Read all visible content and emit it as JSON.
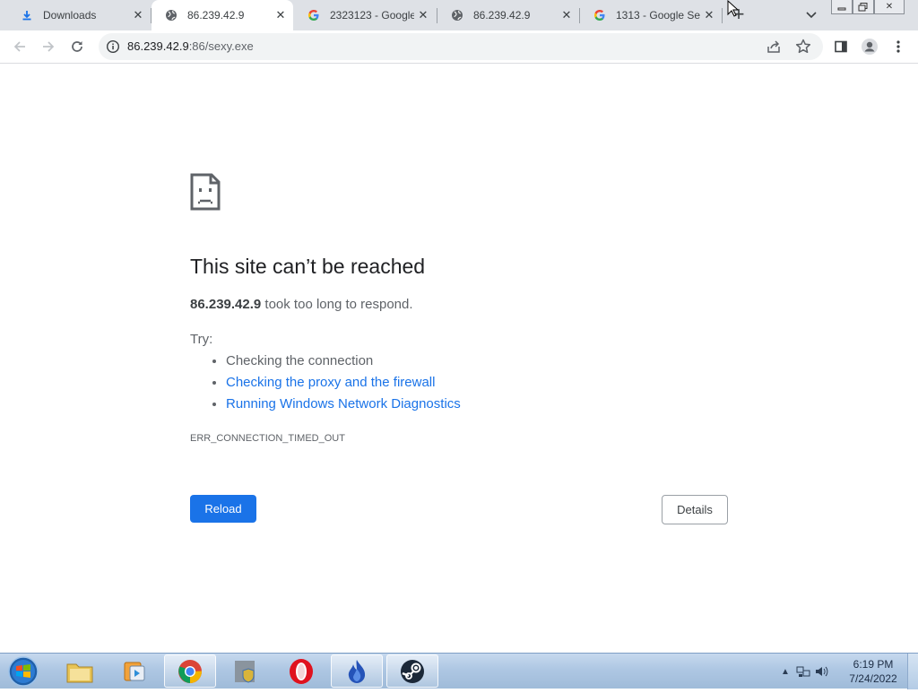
{
  "browser": {
    "tabs": [
      {
        "title": "Downloads",
        "favicon": "download-icon"
      },
      {
        "title": "86.239.42.9",
        "favicon": "globe-icon",
        "active": true
      },
      {
        "title": "2323123 - Google",
        "favicon": "google-icon"
      },
      {
        "title": "86.239.42.9",
        "favicon": "globe-icon"
      },
      {
        "title": "1313 - Google Se",
        "favicon": "google-icon"
      }
    ],
    "new_tab_label": "+",
    "address": {
      "host": "86.239.42.9",
      "rest": ":86/sexy.exe"
    }
  },
  "error_page": {
    "heading": "This site can’t be reached",
    "host_bold": "86.239.42.9",
    "message_rest": " took too long to respond.",
    "try_label": "Try:",
    "suggestions": [
      {
        "text": "Checking the connection",
        "link": false
      },
      {
        "text": "Checking the proxy and the firewall",
        "link": true
      },
      {
        "text": "Running Windows Network Diagnostics",
        "link": true
      }
    ],
    "error_code": "ERR_CONNECTION_TIMED_OUT",
    "reload_label": "Reload",
    "details_label": "Details"
  },
  "taskbar": {
    "apps": [
      "windows-explorer",
      "media-player",
      "chrome",
      "security-shield",
      "opera",
      "blue-app",
      "steam"
    ],
    "clock_time": "6:19 PM",
    "clock_date": "7/24/2022"
  },
  "colors": {
    "link": "#1a73e8",
    "primary_button": "#1a73e8",
    "tabstrip": "#dee1e6"
  }
}
